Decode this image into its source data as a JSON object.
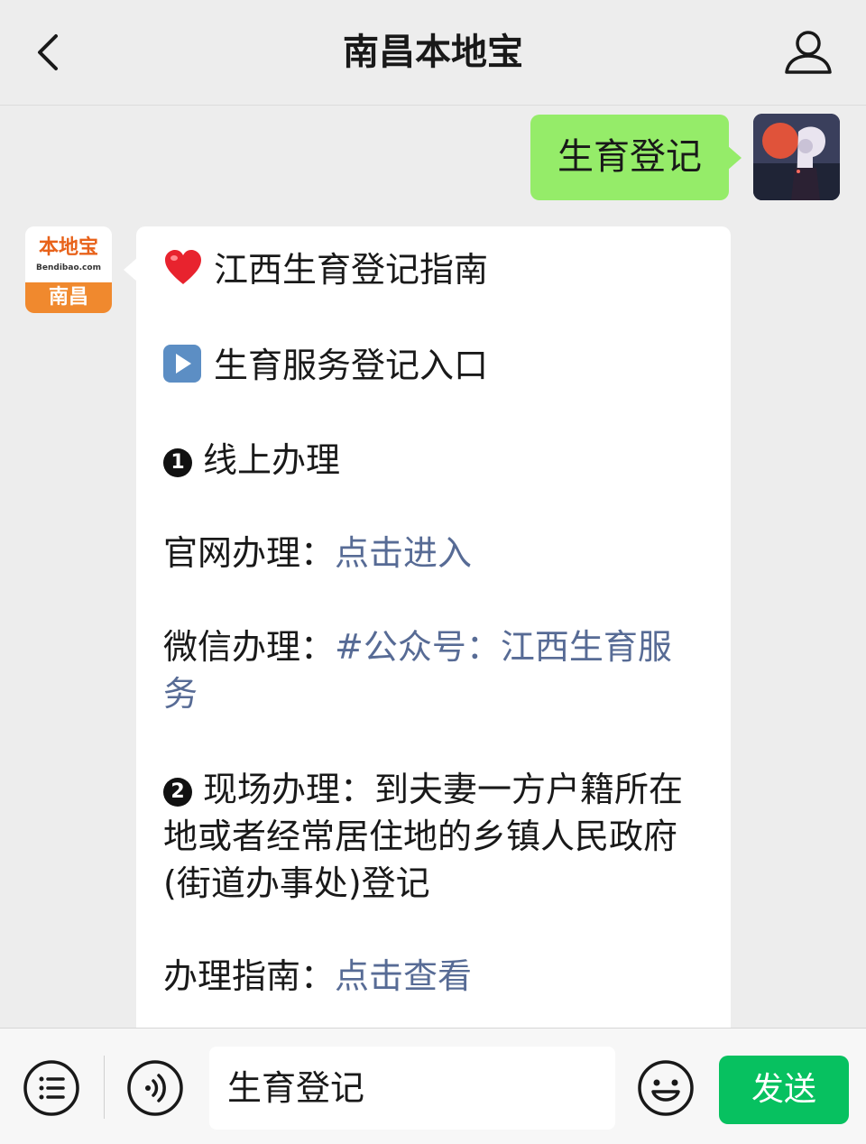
{
  "nav": {
    "title": "南昌本地宝",
    "back_icon": "chevron-left-icon",
    "profile_icon": "user-icon"
  },
  "outgoing": {
    "text": "生育登记",
    "bubble_color": "#95ec69"
  },
  "incoming": {
    "avatar": {
      "brand": "本地宝",
      "domain": "Bendibao.com",
      "city": "南昌",
      "brand_color": "#e8621a",
      "city_bg": "#f0892e"
    },
    "title": "江西生育登记指南",
    "entry": "生育服务登记入口",
    "online": {
      "number": "1",
      "label": "线上办理"
    },
    "website": {
      "label": "官网办理：",
      "link": "点击进入"
    },
    "wechat": {
      "label": "微信办理：",
      "link_line1": "#公众号：江西生育服",
      "link_line2": "务"
    },
    "onsite": {
      "number": "2",
      "line1": "现场办理：到夫妻一方户籍所在",
      "line2": "地或者经常居住地的乡镇人民政府",
      "line3": "(街道办事处)登记"
    },
    "guide": {
      "label": "办理指南：",
      "link": "点击查看"
    },
    "link_color": "#576b95"
  },
  "inputbar": {
    "menu_icon": "list-menu-icon",
    "voice_icon": "voice-icon",
    "input_value": "生育登记",
    "emoji_icon": "smiley-icon",
    "send_label": "发送",
    "send_color": "#07c160"
  }
}
